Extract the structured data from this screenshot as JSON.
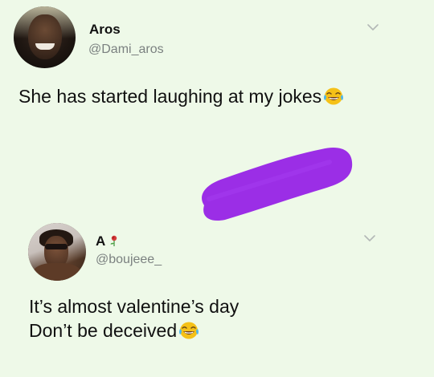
{
  "tweets": [
    {
      "display_name": "Aros",
      "handle": "@Dami_aros",
      "text_lines": [
        "She has started laughing at my jokes"
      ],
      "trailing_emoji": "face-with-tears-of-joy-icon"
    },
    {
      "display_name": "A",
      "name_emoji": "rose-icon",
      "handle": "@boujeee_",
      "text_lines": [
        "It’s almost valentine’s day",
        "Don’t be deceived"
      ],
      "trailing_emoji": "face-with-tears-of-joy-icon"
    }
  ],
  "colors": {
    "background": "#eef9e8",
    "redaction": "#9b2ee6",
    "handle": "#7b8180",
    "emoji_face": "#f5c118"
  }
}
